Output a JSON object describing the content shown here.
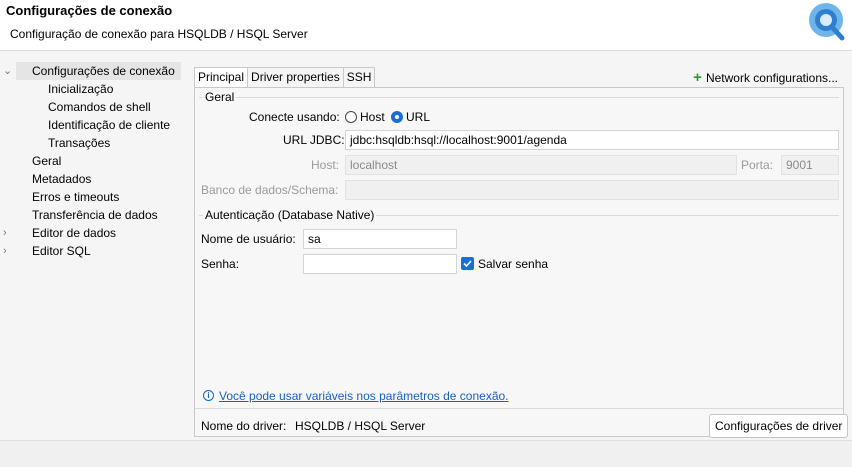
{
  "header": {
    "title": "Configurações de conexão",
    "subtitle": "Configuração de conexão para HSQLDB / HSQL Server"
  },
  "tree": {
    "items": [
      {
        "label": "Configurações de conexão",
        "arrow": "⌄"
      },
      {
        "label": "Inicialização"
      },
      {
        "label": "Comandos de shell"
      },
      {
        "label": "Identificação de cliente"
      },
      {
        "label": "Transações"
      },
      {
        "label": "Geral"
      },
      {
        "label": "Metadados"
      },
      {
        "label": "Erros e timeouts"
      },
      {
        "label": "Transferência de dados"
      },
      {
        "label": "Editor de dados",
        "arrow": "›"
      },
      {
        "label": "Editor SQL",
        "arrow": "›"
      }
    ]
  },
  "tabs": [
    "Principal",
    "Driver properties",
    "SSH"
  ],
  "network_configurations": "Network configurations...",
  "geral": {
    "group_label": "Geral",
    "connect_label": "Conecte usando:",
    "option_host": "Host",
    "option_url": "URL",
    "url_label": "URL JDBC:",
    "url_value": "jdbc:hsqldb:hsql://localhost:9001/agenda",
    "host_label": "Host:",
    "host_value": "localhost",
    "port_label": "Porta:",
    "port_value": "9001",
    "db_label": "Banco de dados/Schema:",
    "db_value": ""
  },
  "auth": {
    "group_label": "Autenticação (Database Native)",
    "user_label": "Nome de usuário:",
    "user_value": "sa",
    "password_label": "Senha:",
    "password_value": "",
    "save_password": "Salvar senha"
  },
  "hint": "Você pode usar variáveis nos parâmetros de conexão.",
  "driver": {
    "label": "Nome do driver:",
    "value": "HSQLDB / HSQL Server",
    "button": "Configurações de driver"
  },
  "colors": {
    "accent": "#1a6fd6",
    "link": "#1560c0",
    "plus": "#2e9a2e"
  }
}
